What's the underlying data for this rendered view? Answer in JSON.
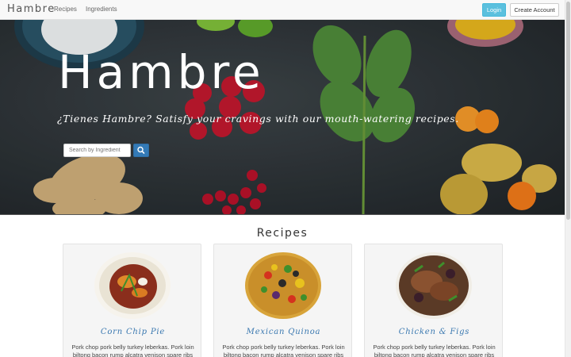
{
  "navbar": {
    "brand": "Hambre",
    "links": [
      "Recipes",
      "Ingredients"
    ],
    "login_label": "Login",
    "create_account_label": "Create Account"
  },
  "hero": {
    "title": "Hambre",
    "subtitle": "¿Tienes Hambre? Satisfy your cravings with our mouth-watering recipes.",
    "search_placeholder": "Search by Ingredient",
    "search_icon": "search-icon"
  },
  "recipes": {
    "heading": "Recipes",
    "cards": [
      {
        "title": "Corn Chip Pie",
        "description": "Pork chop pork belly turkey leberkas. Pork loin biltong bacon rump alcatra venison spare ribs"
      },
      {
        "title": "Mexican Quinoa",
        "description": "Pork chop pork belly turkey leberkas. Pork loin biltong bacon rump alcatra venison spare ribs"
      },
      {
        "title": "Chicken & Figs",
        "description": "Pork chop pork belly turkey leberkas. Pork loin biltong bacon rump alcatra venison spare ribs"
      }
    ]
  },
  "colors": {
    "login_button": "#5bc0de",
    "search_button": "#337ab7",
    "card_title": "#3a78b0",
    "hero_background": "#2c3236"
  }
}
